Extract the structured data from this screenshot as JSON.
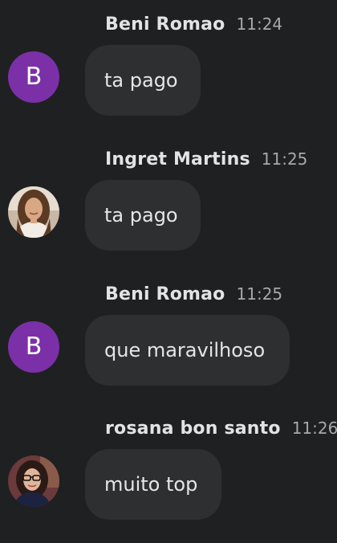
{
  "messages": [
    {
      "sender": "Beni Romao",
      "time": "11:24",
      "text": "ta pago",
      "avatar": {
        "type": "letter",
        "letter": "B",
        "color": "#7b30a8"
      }
    },
    {
      "sender": "Ingret Martins",
      "time": "11:25",
      "text": "ta pago",
      "avatar": {
        "type": "photo"
      }
    },
    {
      "sender": "Beni Romao",
      "time": "11:25",
      "text": "que maravilhoso",
      "avatar": {
        "type": "letter",
        "letter": "B",
        "color": "#7b30a8"
      }
    },
    {
      "sender": "rosana bon santo",
      "time": "11:26",
      "text": "muito top",
      "avatar": {
        "type": "photo"
      }
    }
  ],
  "colors": {
    "background": "#1f2022",
    "bubble": "#2e2f31",
    "sender_text": "#e3e3e3",
    "time_text": "#a8a8a8"
  }
}
